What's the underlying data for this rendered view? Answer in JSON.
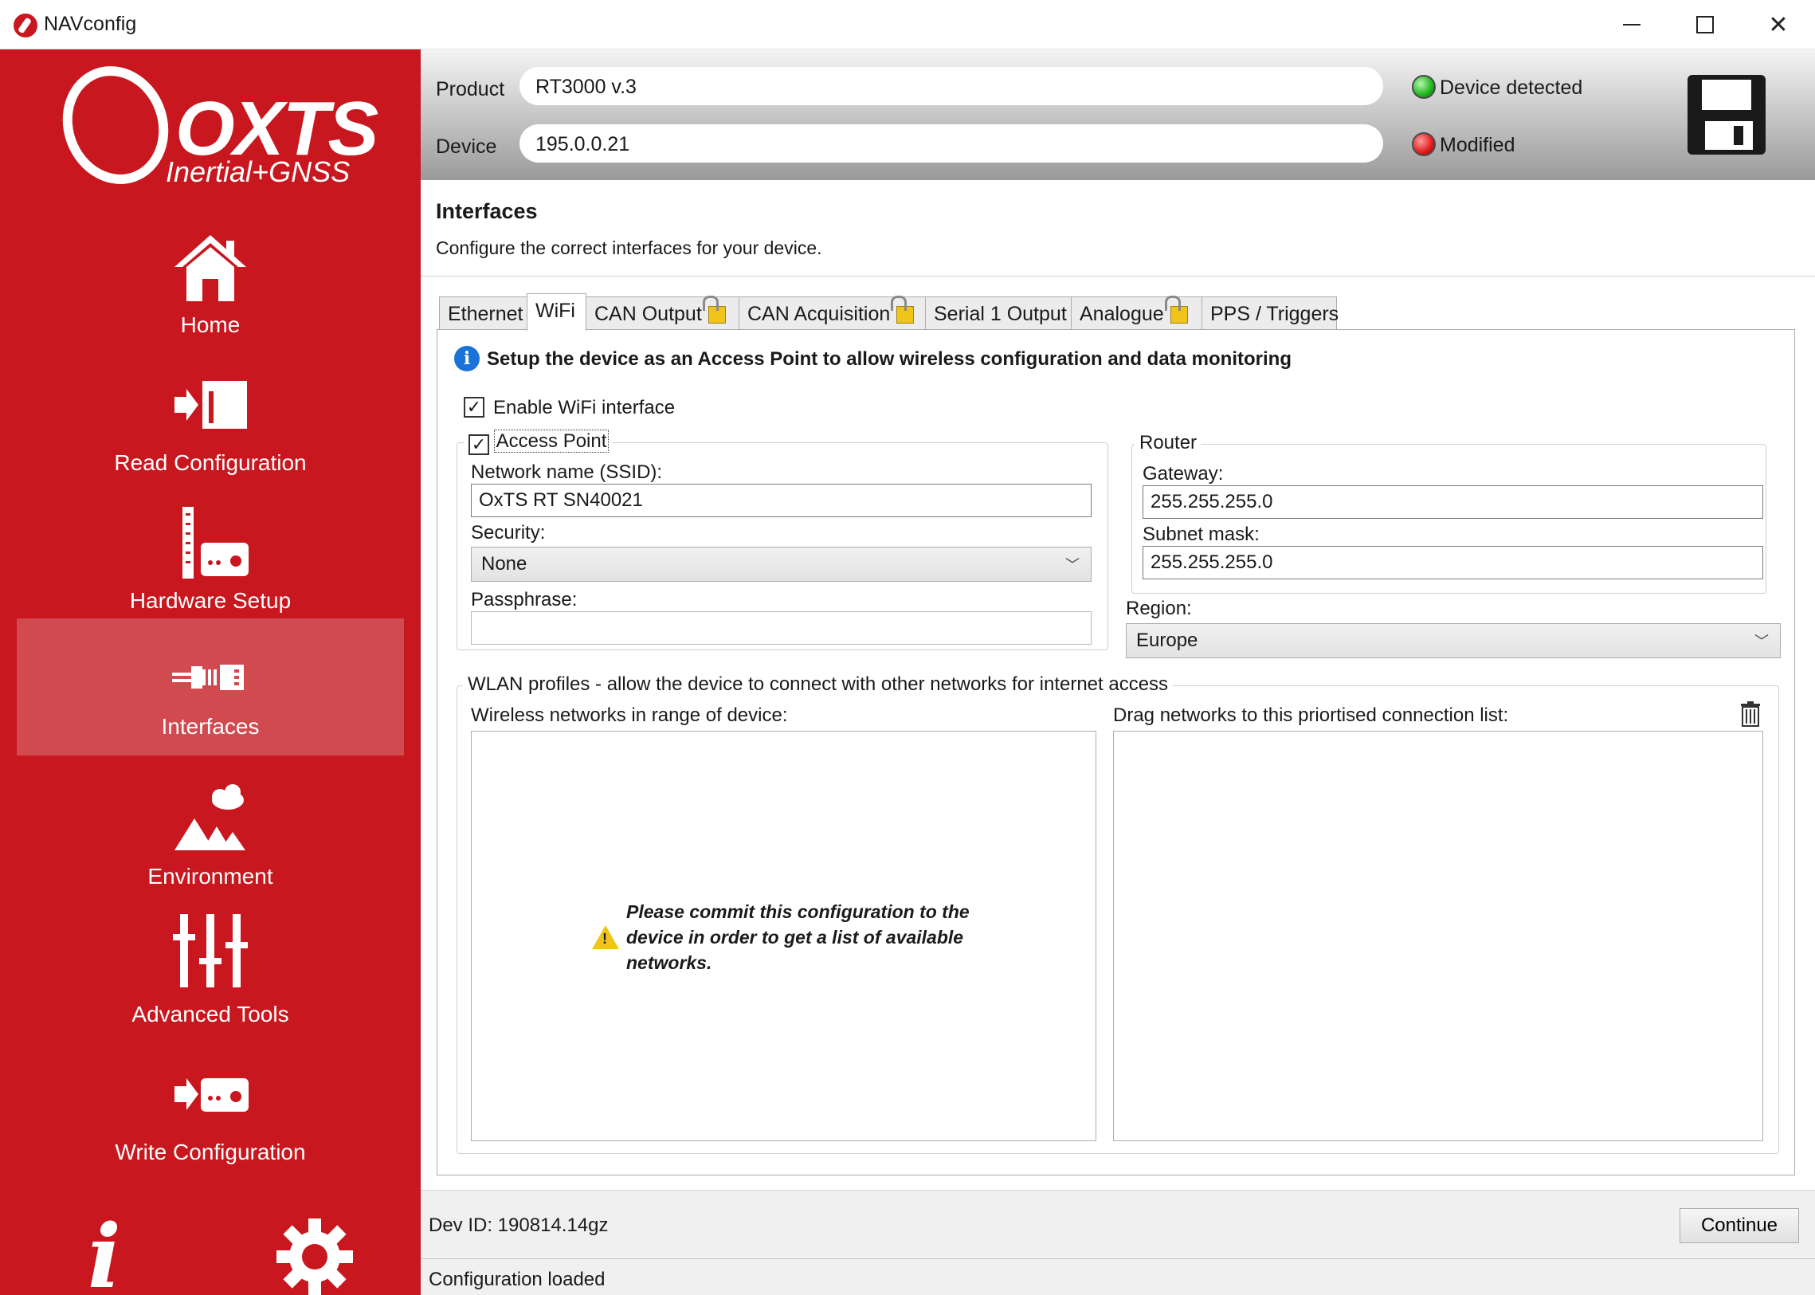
{
  "window": {
    "title": "NAVconfig"
  },
  "logo": {
    "brand": "OXTS",
    "tagline": "Inertial+GNSS"
  },
  "sidebar": {
    "items": [
      {
        "label": "Home",
        "icon": "home-icon"
      },
      {
        "label": "Read Configuration",
        "icon": "read-config-icon"
      },
      {
        "label": "Hardware Setup",
        "icon": "hardware-icon"
      },
      {
        "label": "Interfaces",
        "icon": "interfaces-icon",
        "active": true
      },
      {
        "label": "Environment",
        "icon": "environment-icon"
      },
      {
        "label": "Advanced Tools",
        "icon": "sliders-icon"
      },
      {
        "label": "Write Configuration",
        "icon": "write-config-icon"
      }
    ],
    "info_glyph": "i"
  },
  "header": {
    "product_label": "Product",
    "product_value": "RT3000 v.3",
    "device_label": "Device",
    "device_value": "195.0.0.21",
    "status_detected": "Device detected",
    "status_modified": "Modified"
  },
  "section": {
    "title": "Interfaces",
    "description": "Configure the correct interfaces for your device."
  },
  "tabs": [
    {
      "label": "Ethernet",
      "locked": false
    },
    {
      "label": "WiFi",
      "locked": false,
      "active": true
    },
    {
      "label": "CAN Output",
      "locked": true
    },
    {
      "label": "CAN Acquisition",
      "locked": true
    },
    {
      "label": "Serial 1 Output",
      "locked": false
    },
    {
      "label": "Analogue",
      "locked": true
    },
    {
      "label": "PPS / Triggers",
      "locked": false
    }
  ],
  "wifi": {
    "info": "Setup the device as an Access Point to allow wireless configuration and data monitoring",
    "enable_label": "Enable WiFi interface",
    "enable_checked": true,
    "ap_label": "Access Point",
    "ap_checked": true,
    "ssid_label": "Network name (SSID):",
    "ssid_value": "OxTS RT SN40021",
    "security_label": "Security:",
    "security_value": "None",
    "passphrase_label": "Passphrase:",
    "passphrase_value": "",
    "router_legend": "Router",
    "gateway_label": "Gateway:",
    "gateway_value": "255.255.255.0",
    "subnet_label": "Subnet mask:",
    "subnet_value": "255.255.255.0",
    "region_label": "Region:",
    "region_value": "Europe",
    "wlan_legend": "WLAN profiles - allow the device to connect with other networks for internet access",
    "in_range_label": "Wireless networks in range of device:",
    "priority_label": "Drag networks to this priortised connection list:",
    "warning": "Please commit this configuration to the device in order to get a list of available networks."
  },
  "footer": {
    "dev_id": "Dev ID: 190814.14gz",
    "continue_label": "Continue",
    "status": "Configuration loaded"
  },
  "colors": {
    "brand_red": "#c8171e",
    "active_nav": "#d04a4f",
    "info_blue": "#1a73d9",
    "warning_yellow": "#f0c419"
  }
}
